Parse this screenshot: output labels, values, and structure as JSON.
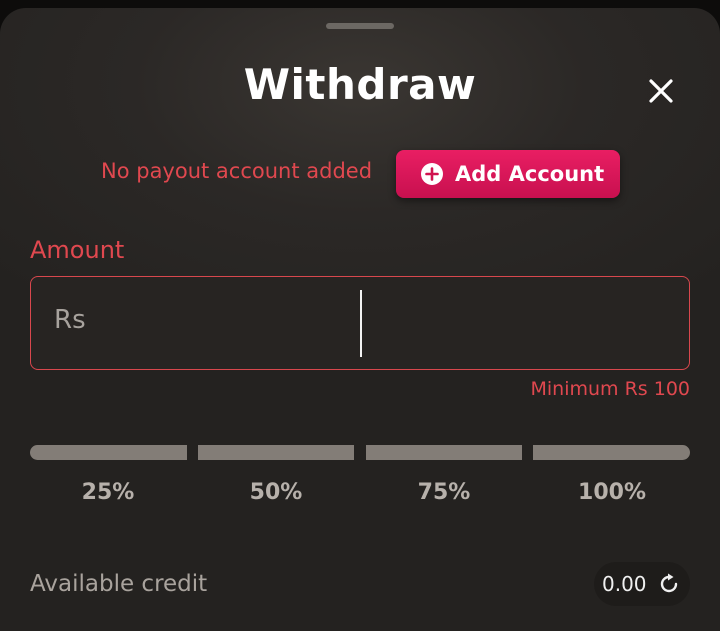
{
  "modal": {
    "title": "Withdraw",
    "close_icon": "close-icon"
  },
  "payout": {
    "status_text": "No payout account added",
    "add_button_label": "Add Account",
    "add_icon": "plus-circle-icon",
    "accent_color": "#e91e63"
  },
  "amount": {
    "label": "Amount",
    "prefix": "Rs",
    "value": "",
    "minimum_text": "Minimum Rs 100",
    "error_color": "#e0484f"
  },
  "percent_options": [
    {
      "label": "25%",
      "value": 0.25
    },
    {
      "label": "50%",
      "value": 0.5
    },
    {
      "label": "75%",
      "value": 0.75
    },
    {
      "label": "100%",
      "value": 1.0
    }
  ],
  "credit": {
    "label": "Available credit",
    "value": "0.00",
    "refresh_icon": "refresh-icon"
  }
}
